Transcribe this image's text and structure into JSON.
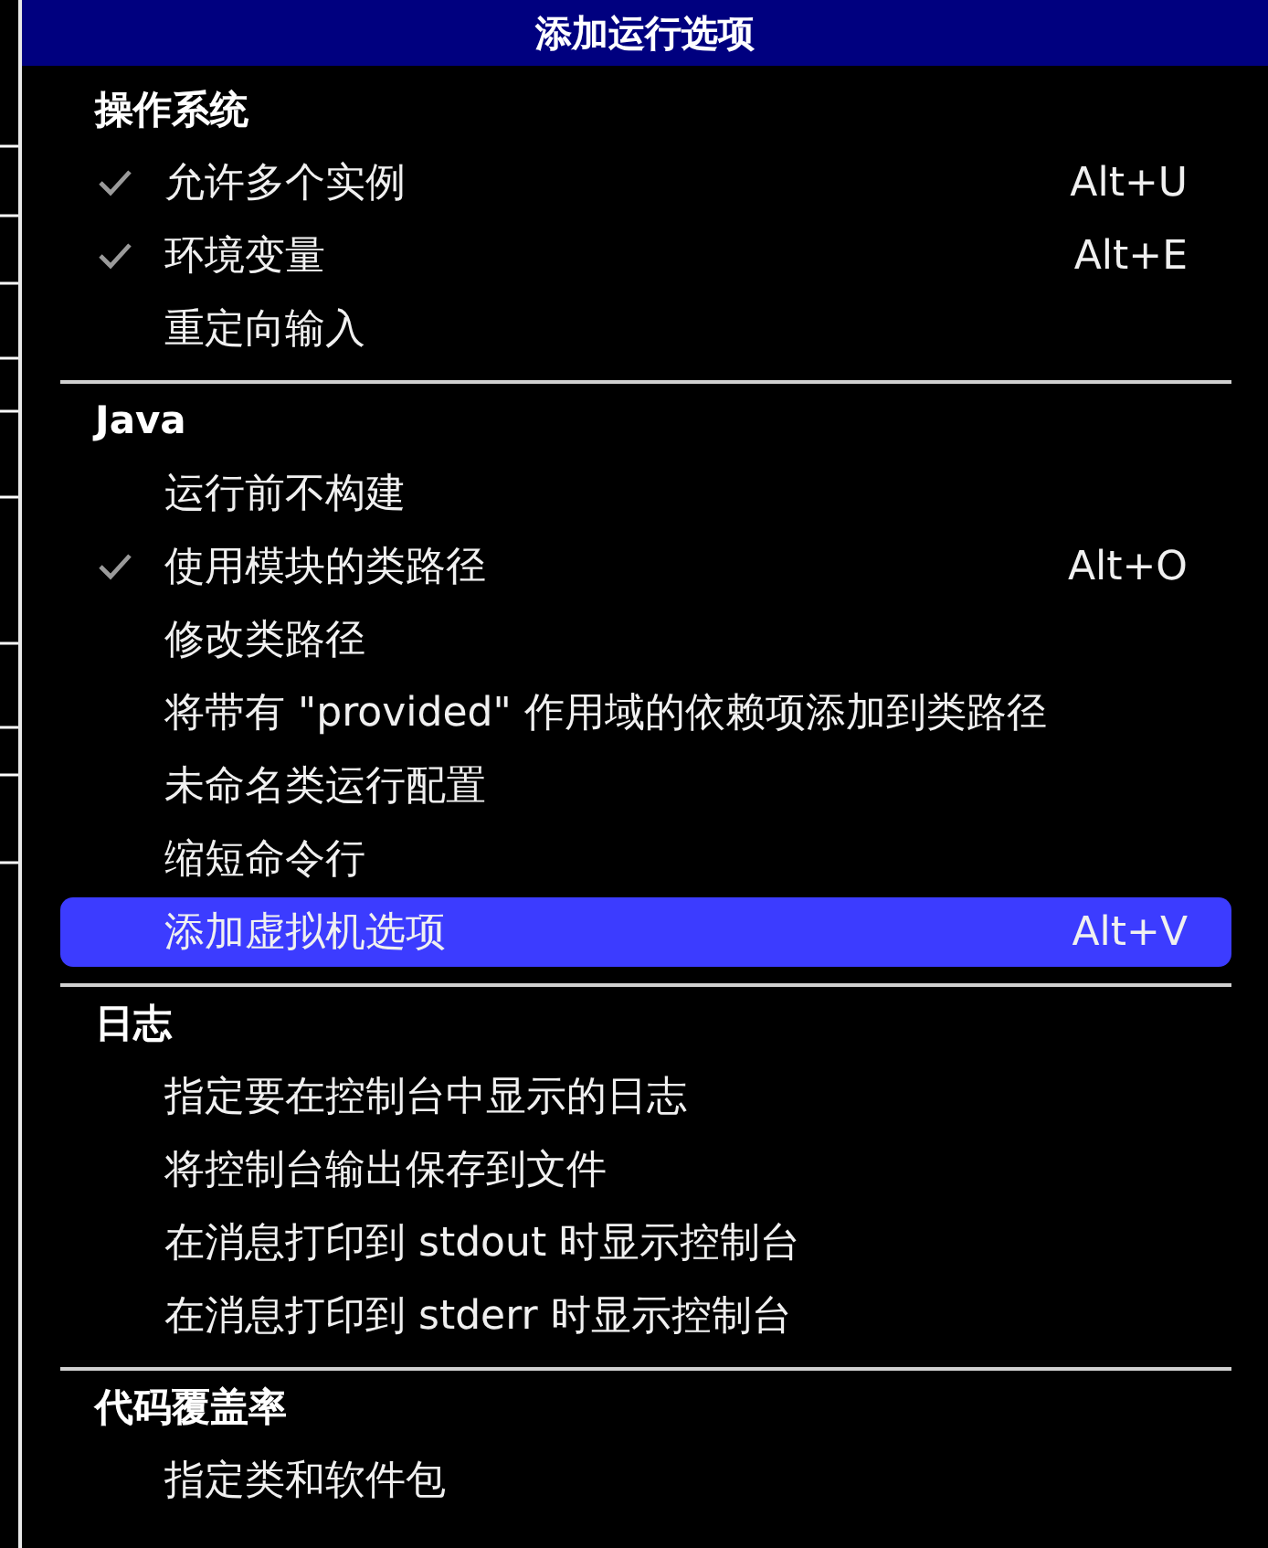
{
  "window": {
    "title": "添加运行选项"
  },
  "sections": [
    {
      "header": "操作系统",
      "items": [
        {
          "label": "允许多个实例",
          "checked": true,
          "shortcut": "Alt+U",
          "selected": false
        },
        {
          "label": "环境变量",
          "checked": true,
          "shortcut": "Alt+E",
          "selected": false
        },
        {
          "label": "重定向输入",
          "checked": false,
          "selected": false
        }
      ]
    },
    {
      "header": "Java",
      "items": [
        {
          "label": "运行前不构建",
          "checked": false,
          "selected": false
        },
        {
          "label": "使用模块的类路径",
          "checked": true,
          "shortcut": "Alt+O",
          "selected": false
        },
        {
          "label": "修改类路径",
          "checked": false,
          "selected": false
        },
        {
          "label": "将带有 \"provided\" 作用域的依赖项添加到类路径",
          "checked": false,
          "selected": false
        },
        {
          "label": "未命名类运行配置",
          "checked": false,
          "selected": false
        },
        {
          "label": "缩短命令行",
          "checked": false,
          "selected": false
        },
        {
          "label": "添加虚拟机选项",
          "checked": false,
          "shortcut": "Alt+V",
          "selected": true
        }
      ]
    },
    {
      "header": "日志",
      "items": [
        {
          "label": "指定要在控制台中显示的日志",
          "checked": false,
          "selected": false
        },
        {
          "label": "将控制台输出保存到文件",
          "checked": false,
          "selected": false
        },
        {
          "label": "在消息打印到 stdout 时显示控制台",
          "checked": false,
          "selected": false
        },
        {
          "label": "在消息打印到 stderr 时显示控制台",
          "checked": false,
          "selected": false
        }
      ]
    },
    {
      "header": "代码覆盖率",
      "items": [
        {
          "label": "指定类和软件包",
          "checked": false,
          "selected": false
        }
      ]
    }
  ]
}
